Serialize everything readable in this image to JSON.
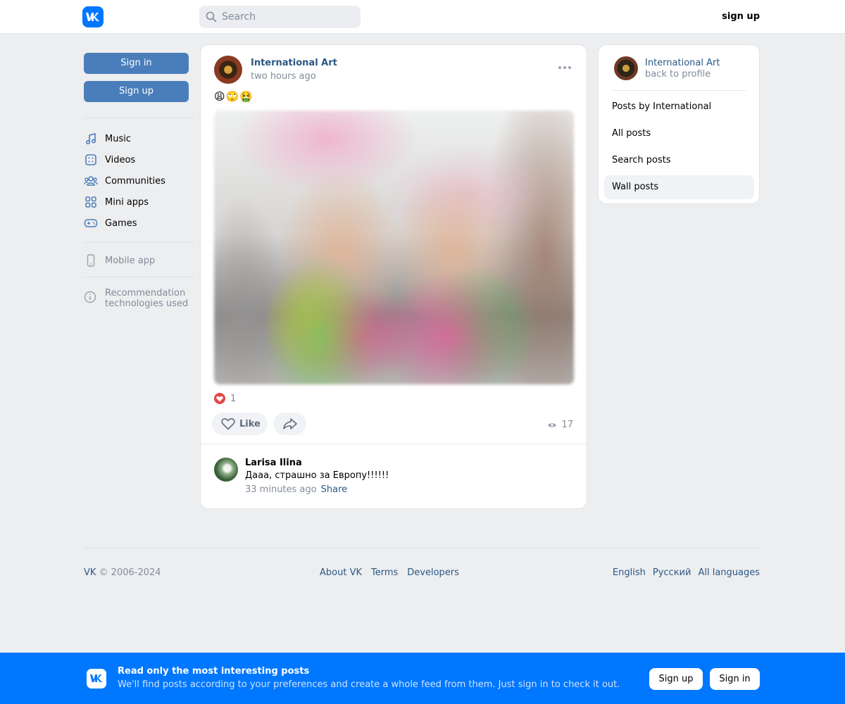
{
  "header": {
    "search_placeholder": "Search",
    "signup_label": "sign up"
  },
  "sidebar": {
    "signin_label": "Sign in",
    "signup_label": "Sign up",
    "items": [
      {
        "label": "Music",
        "icon": "music-icon"
      },
      {
        "label": "Videos",
        "icon": "video-icon"
      },
      {
        "label": "Communities",
        "icon": "communities-icon"
      },
      {
        "label": "Mini apps",
        "icon": "mini-apps-icon"
      },
      {
        "label": "Games",
        "icon": "gamepad-icon"
      }
    ],
    "mobile_app_label": "Mobile app",
    "recommendation_label": "Recommendation technologies used"
  },
  "post": {
    "author": "International Art",
    "time": "two hours ago",
    "emojis": "😩🙄🤮",
    "likes_count": "1",
    "like_label": "Like",
    "views_count": "17"
  },
  "comment": {
    "author": "Larisa Ilina",
    "text": "Дааа, страшно за Европу!!!!!!",
    "time": "33 minutes ago",
    "share_label": "Share"
  },
  "rightcard": {
    "name": "International Art",
    "back_label": "back to profile",
    "items": [
      {
        "label": "Posts by International",
        "active": false
      },
      {
        "label": "All posts",
        "active": false
      },
      {
        "label": "Search posts",
        "active": false
      },
      {
        "label": "Wall posts",
        "active": true
      }
    ]
  },
  "footer": {
    "copyright_vk": "VK",
    "copyright_rest": " © 2006-2024",
    "links": [
      "About VK",
      "Terms",
      "Developers"
    ],
    "languages": [
      "English",
      "Русский",
      "All languages"
    ]
  },
  "banner": {
    "title": "Read only the most interesting posts",
    "subtitle": "We'll find posts according to your preferences and create a whole feed from them. Just sign in to check it out.",
    "signup_label": "Sign up",
    "signin_label": "Sign in"
  },
  "colors": {
    "accent": "#0077ff",
    "button_blue": "#4a7ebb",
    "link": "#2a5885",
    "background": "#edeef0"
  }
}
